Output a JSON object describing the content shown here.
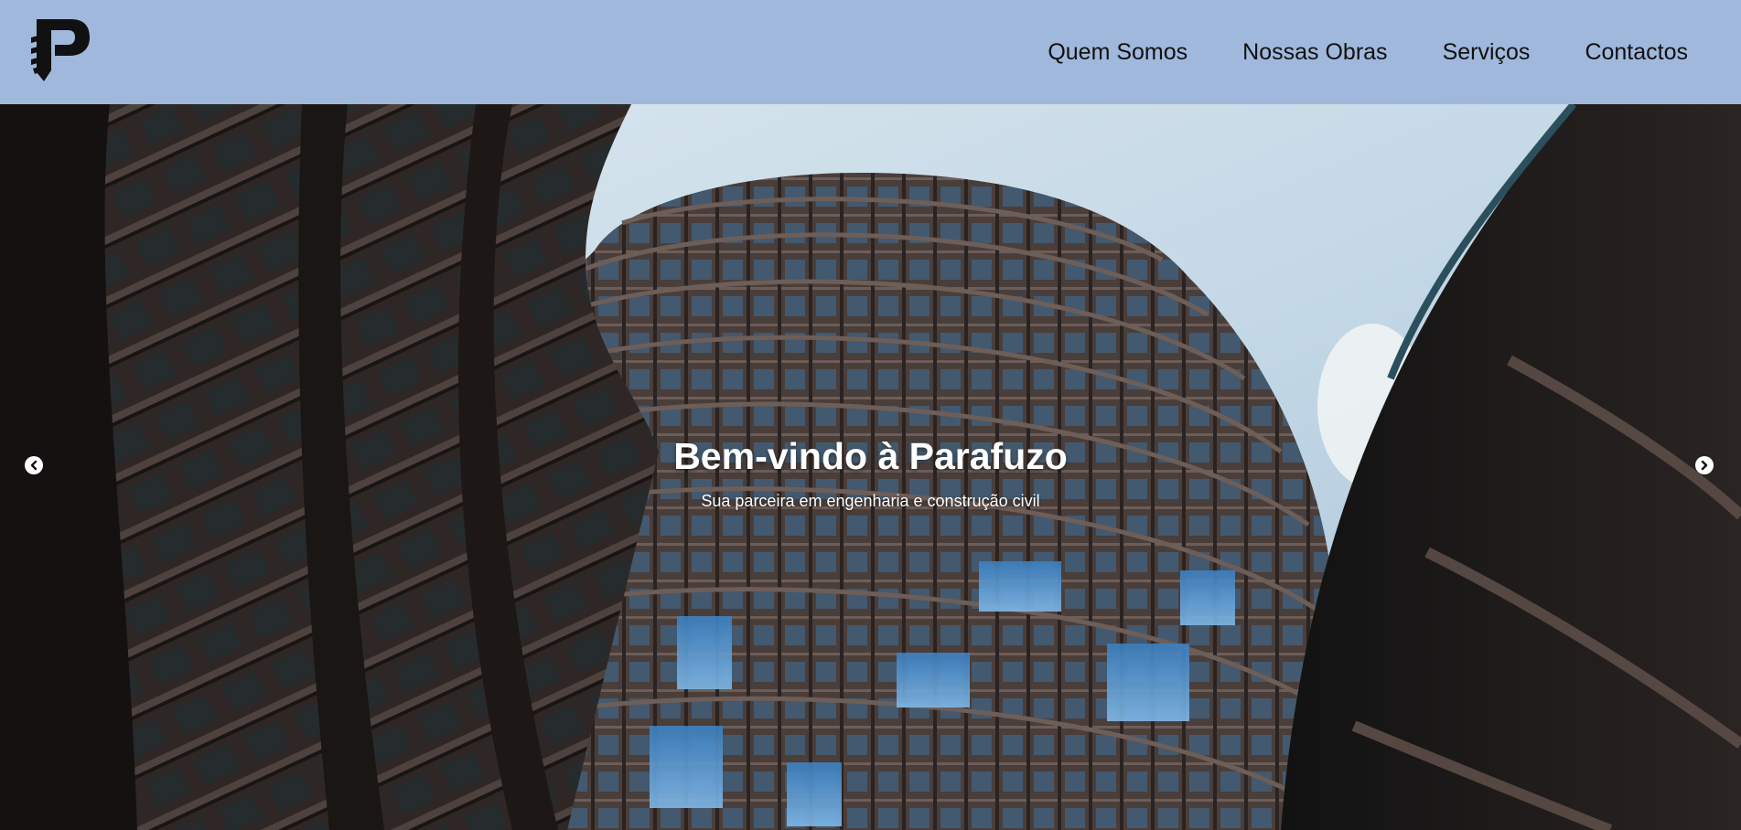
{
  "header": {
    "logo_icon": "parafuzo-screw-p-logo",
    "nav": [
      {
        "label": "Quem Somos"
      },
      {
        "label": "Nossas Obras"
      },
      {
        "label": "Serviços"
      },
      {
        "label": "Contactos"
      }
    ],
    "background_color": "#a0b8dc"
  },
  "hero": {
    "title": "Bem-vindo à Parafuzo",
    "subtitle": "Sua parceira em engenharia e construção civil",
    "prev_icon": "chevron-left-icon",
    "next_icon": "chevron-right-icon"
  }
}
